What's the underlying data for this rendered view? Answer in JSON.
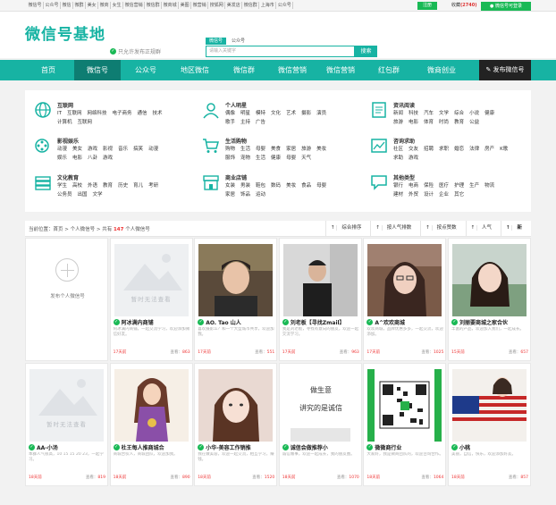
{
  "topbar": {
    "links": [
      "微信号",
      "公众号",
      "微信",
      "微群",
      "美女",
      "微商",
      "女生",
      "微信营销",
      "微信群",
      "微商城",
      "美图",
      "微营销",
      "搜狐网",
      "美发店",
      "微信群",
      "上海市",
      "公众号"
    ],
    "register": "注册",
    "favorites_prefix": "收藏",
    "favorites_count": "(2740)",
    "wx_button": "微信号可登录"
  },
  "header": {
    "logo": "微信号基地",
    "slogan": "只允许发布正规群",
    "search_tabs": [
      "微信号",
      "公众号"
    ],
    "search_placeholder": "请输入关键字",
    "search_button": "搜索"
  },
  "nav": {
    "items": [
      "首页",
      "微信号",
      "公众号",
      "地区微信",
      "微信群",
      "微信营销",
      "微信营销",
      "红包群",
      "微商创业"
    ],
    "publish": "发布微信号"
  },
  "categories": [
    {
      "title": "互联网",
      "tags": [
        "IT",
        "互联网",
        "网络科技",
        "电子商务",
        "通信",
        "技术",
        "计算机",
        "互联网"
      ]
    },
    {
      "title": "个人明星",
      "tags": [
        "偶像",
        "明星",
        "模特",
        "文化",
        "艺术",
        "摄影",
        "演员",
        "歌手",
        "主持",
        "广告"
      ]
    },
    {
      "title": "资讯阅读",
      "tags": [
        "新闻",
        "科技",
        "汽车",
        "文学",
        "综合",
        "小说",
        "健康",
        "旅游",
        "电影",
        "体育",
        "时尚",
        "教育",
        "公益"
      ]
    },
    {
      "title": "影视娱乐",
      "tags": [
        "动漫",
        "美女",
        "游戏",
        "影视",
        "音乐",
        "搞笑",
        "动漫",
        "娱乐",
        "电影",
        "八卦",
        "游戏"
      ]
    },
    {
      "title": "生活购物",
      "tags": [
        "购物",
        "生活",
        "母婴",
        "美食",
        "家居",
        "旅游",
        "美妆",
        "服饰",
        "宠物",
        "生活",
        "健康",
        "母婴",
        "天气"
      ]
    },
    {
      "title": "咨询求助",
      "tags": [
        "社区",
        "交友",
        "招聘",
        "求职",
        "婚恋",
        "法律",
        "房产",
        "K歌",
        "求助",
        "游戏"
      ]
    },
    {
      "title": "文化教育",
      "tags": [
        "学生",
        "高校",
        "外语",
        "教育",
        "历史",
        "育儿",
        "考研",
        "公务员",
        "出国",
        "文学"
      ]
    },
    {
      "title": "商业店铺",
      "tags": [
        "女装",
        "男装",
        "鞋包",
        "数码",
        "美妆",
        "食品",
        "母婴",
        "家居",
        "饰品",
        "运动"
      ]
    },
    {
      "title": "其他类型",
      "tags": [
        "银行",
        "电商",
        "保险",
        "医疗",
        "护理",
        "生产",
        "物流",
        "建材",
        "外贸",
        "设计",
        "企业",
        "其它"
      ]
    }
  ],
  "crumb": {
    "prefix": "当前位置：首页 > 个人微信号 > 共有",
    "count": "147",
    "suffix": "个人微信号"
  },
  "sorts": [
    "综合排序",
    "按人气排数",
    "按点赞数",
    "人气",
    "新"
  ],
  "add_card": {
    "label": "发布个人微信号"
  },
  "cards": [
    {
      "name": "阿冰满内商铺",
      "desc": "阿冰满内商铺，一起交流学习，欢迎添加微信好友。",
      "time": "17天前",
      "views_label": "查看：",
      "views": "863",
      "photo": "noimg"
    },
    {
      "name": "AO. Tao 山人",
      "desc": "喜欢摄影么？和一个大型城市共享，欢迎加我。",
      "time": "17天前",
      "views_label": "查看：",
      "views": "551",
      "photo": "man1"
    },
    {
      "name": "刘老板【寻找Zmail】",
      "desc": "我是刘老板，寻找有意向的朋友，欢迎一起交流学习。",
      "time": "17天前",
      "views_label": "查看：",
      "views": "963",
      "photo": "man2"
    },
    {
      "name": "A^欢欢商城",
      "desc": "欢欢商城，品牌优惠多多，一起交流，欢迎添加。",
      "time": "17天前",
      "views_label": "查看：",
      "views": "1025",
      "photo": "woman1"
    },
    {
      "name": "刘丽要商城之家合伙",
      "desc": "丰富的产品，欢迎加入我们，一起成长。",
      "time": "15天前",
      "views_label": "查看：",
      "views": "657",
      "photo": "woman2"
    },
    {
      "name": "AA-小汤",
      "desc": "本群人气很高，10 15 15 20 23，一起学习。",
      "time": "18天前",
      "views_label": "查看：",
      "views": "819",
      "photo": "noimg"
    },
    {
      "name": "杜王每人推商城合",
      "desc": "商城合伙人，商城团队，欢迎加我。",
      "time": "18天前",
      "views_label": "查看：",
      "views": "890",
      "photo": "anime"
    },
    {
      "name": "小华-美容工作销推",
      "desc": "我在做美容，欢迎一起交流，相互学习，赚钱。",
      "time": "18天前",
      "views_label": "查看：",
      "views": "1520",
      "photo": "woman3"
    },
    {
      "name": "诚信会做推荐小",
      "desc": "诚信做事，欢迎一起成长，我的朋友圈。",
      "time": "18天前",
      "views_label": "查看：",
      "views": "1070",
      "photo": "text"
    },
    {
      "name": "微微商行业",
      "desc": "大家好，我是微商团队的，欢迎咨询合作。",
      "time": "18天前",
      "views_label": "查看：",
      "views": "1064",
      "photo": "qr"
    },
    {
      "name": "小桃",
      "desc": "美丽，自信，快乐，欢迎添加好友。",
      "time": "18天前",
      "views_label": "查看：",
      "views": "857",
      "photo": "flag"
    }
  ],
  "photo_placeholder_text": "暂时无法查看",
  "text_photo": {
    "line1": "做生意",
    "line2": "讲究的是诚信"
  },
  "colors": {
    "teal": "#17b3a3",
    "green": "#19b955",
    "dark": "#222222",
    "red": "#e33333"
  }
}
